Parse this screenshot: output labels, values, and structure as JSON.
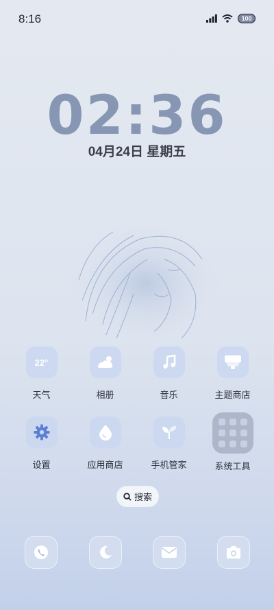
{
  "status_bar": {
    "time": "8:16",
    "battery": "100"
  },
  "lock": {
    "clock": "02:36",
    "date": "04月24日 星期五"
  },
  "apps": [
    {
      "label": "天气",
      "icon": "weather-icon",
      "temp": "22°"
    },
    {
      "label": "相册",
      "icon": "gallery-icon"
    },
    {
      "label": "音乐",
      "icon": "music-icon"
    },
    {
      "label": "主题商店",
      "icon": "theme-store-icon"
    },
    {
      "label": "设置",
      "icon": "settings-gear-icon"
    },
    {
      "label": "应用商店",
      "icon": "app-store-drop-icon"
    },
    {
      "label": "手机管家",
      "icon": "phone-manager-leaf-icon"
    },
    {
      "label": "系统工具",
      "icon": "folder-icon"
    }
  ],
  "search": {
    "label": "搜索"
  },
  "dock": [
    {
      "icon": "phone-icon"
    },
    {
      "icon": "moon-icon"
    },
    {
      "icon": "mail-icon"
    },
    {
      "icon": "camera-icon"
    }
  ],
  "colors": {
    "accent": "#8797b3",
    "icon_bg": "#c8d6f0",
    "icon_fg": "#ffffff",
    "settings_blue": "#5a7fd6"
  }
}
